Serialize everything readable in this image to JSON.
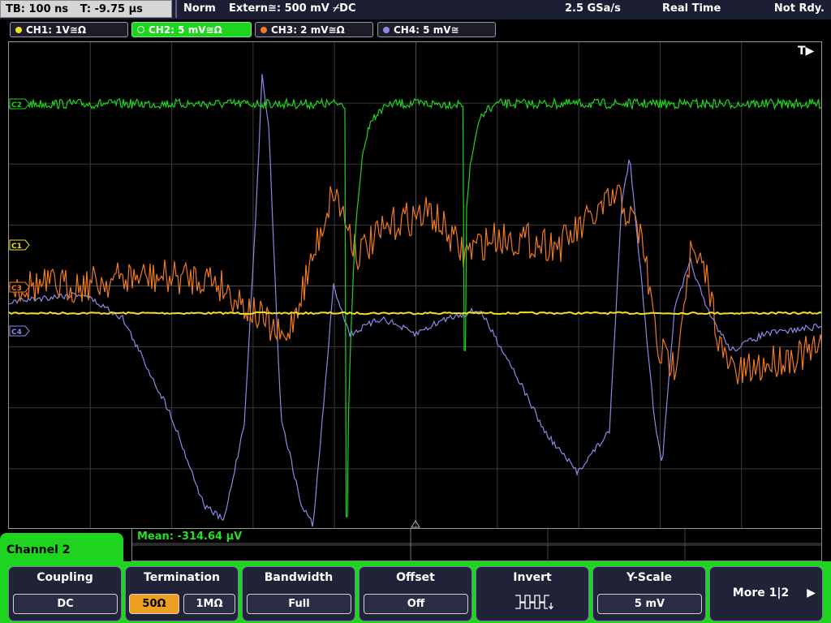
{
  "header": {
    "timebase": "TB: 100 ns",
    "trigger_time": "T: -9.75 µs",
    "trigger_mode": "Norm",
    "trigger_source": "Extern≅: 500 mV ⌿DC",
    "sample_rate": "2.5 GSa/s",
    "acquisition": "Real Time",
    "status": "Not Rdy."
  },
  "channels": [
    {
      "label": "CH1: 1V≅Ω",
      "color": "#f0e020"
    },
    {
      "label": "CH2: 5 mV≅Ω",
      "color": "#1fd41f",
      "active": true
    },
    {
      "label": "CH3: 2 mV≅Ω",
      "color": "#f07a20"
    },
    {
      "label": "CH4: 5 mV≅",
      "color": "#8a8ae8"
    }
  ],
  "screen": {
    "trigger_marker": "T▶",
    "markers": [
      "C1",
      "C3",
      "C4",
      "C2"
    ]
  },
  "measurement": {
    "mean": "Mean: -314.64 µV"
  },
  "panel": {
    "title": "Channel 2"
  },
  "softkeys": {
    "coupling": {
      "label": "Coupling",
      "value": "DC"
    },
    "termination": {
      "label": "Termination",
      "opt1": "50Ω",
      "opt2": "1MΩ"
    },
    "bandwidth": {
      "label": "Bandwidth",
      "value": "Full"
    },
    "offset": {
      "label": "Offset",
      "value": "Off"
    },
    "invert": {
      "label": "Invert"
    },
    "yscale": {
      "label": "Y-Scale",
      "value": "5 mV"
    },
    "more": {
      "label": "More 1|2"
    }
  },
  "colors": {
    "ch1": "#f0e020",
    "ch2": "#1fd41f",
    "ch3": "#f07a20",
    "ch4": "#8a8ae8",
    "grid": "#3a3a3a"
  }
}
